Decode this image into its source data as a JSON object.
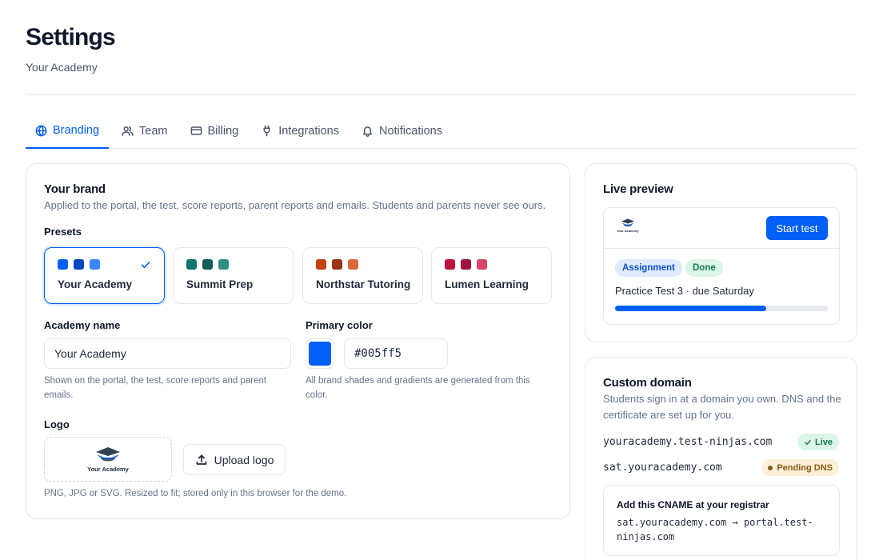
{
  "header": {
    "title": "Settings",
    "subtitle": "Your Academy"
  },
  "tabs": [
    {
      "label": "Branding",
      "icon": "globe-icon",
      "active": true
    },
    {
      "label": "Team",
      "icon": "users-icon",
      "active": false
    },
    {
      "label": "Billing",
      "icon": "credit-card-icon",
      "active": false
    },
    {
      "label": "Integrations",
      "icon": "plug-icon",
      "active": false
    },
    {
      "label": "Notifications",
      "icon": "bell-icon",
      "active": false
    }
  ],
  "brand": {
    "title": "Your brand",
    "description": "Applied to the portal, the test, score reports, parent reports and emails. Students and parents never see ours.",
    "presets_label": "Presets",
    "presets": [
      {
        "name": "Your Academy",
        "colors": [
          "#005ff5",
          "#0846c2",
          "#3d86f7"
        ],
        "selected": true
      },
      {
        "name": "Summit Prep",
        "colors": [
          "#0f766e",
          "#115e59",
          "#2f8f83"
        ],
        "selected": false
      },
      {
        "name": "Northstar Tutoring",
        "colors": [
          "#c2410c",
          "#9a3412",
          "#d9673a"
        ],
        "selected": false
      },
      {
        "name": "Lumen Learning",
        "colors": [
          "#be123c",
          "#9f1239",
          "#d6446a"
        ],
        "selected": false
      }
    ],
    "academy_name_label": "Academy name",
    "academy_name_value": "Your Academy",
    "academy_name_help": "Shown on the portal, the test, score reports and parent emails.",
    "primary_color_label": "Primary color",
    "primary_color_value": "#005ff5",
    "primary_color_help": "All brand shades and gradients are generated from this color.",
    "logo_label": "Logo",
    "logo_text": "Your Academy",
    "upload_label": "Upload logo",
    "logo_help": "PNG, JPG or SVG. Resized to fit; stored only in this browser for the demo."
  },
  "preview": {
    "title": "Live preview",
    "logo_text": "Your Academy",
    "start_button": "Start test",
    "badge_assignment": "Assignment",
    "badge_done": "Done",
    "task": "Practice Test 3 · due Saturday",
    "progress": 0.71
  },
  "domain": {
    "title": "Custom domain",
    "description": "Students sign in at a domain you own. DNS and the certificate are set up for you.",
    "domains": [
      {
        "host": "youracademy.test-ninjas.com",
        "status": "Live"
      },
      {
        "host": "sat.youracademy.com",
        "status": "Pending DNS"
      }
    ],
    "cname_title": "Add this CNAME at your registrar",
    "cname_value": "sat.youracademy.com → portal.test-ninjas.com"
  },
  "colors": {
    "accent": "#005ff5",
    "text": "#0f172a",
    "muted": "#64748b",
    "border": "#e2e8f0"
  }
}
